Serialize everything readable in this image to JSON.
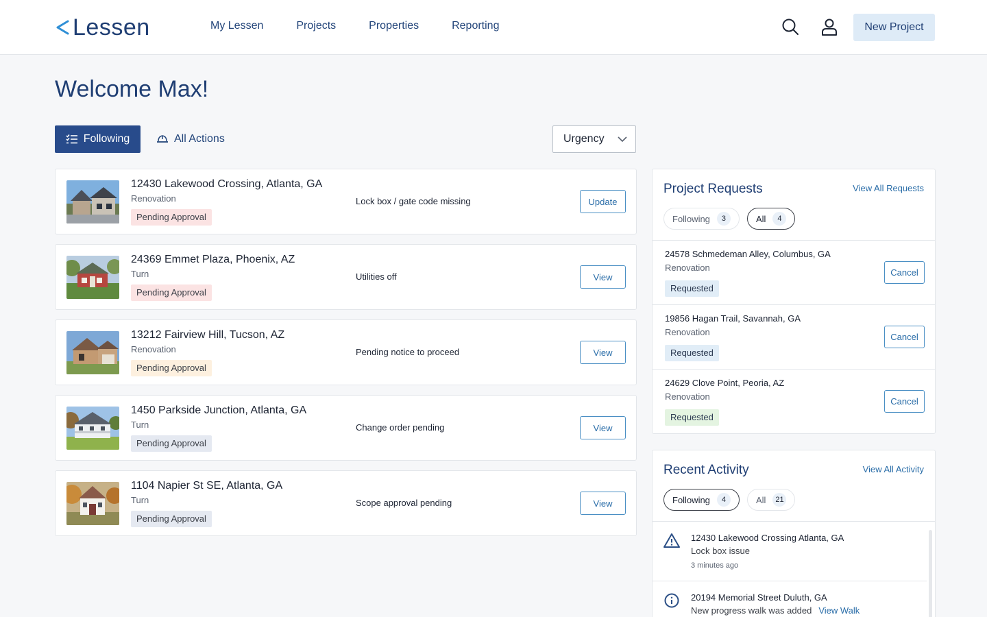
{
  "brand": {
    "name": "Lessen",
    "accent": "#284b8b"
  },
  "nav": [
    "My Lessen",
    "Projects",
    "Properties",
    "Reporting"
  ],
  "header": {
    "new_project": "New Project"
  },
  "welcome": "Welcome Max!",
  "tabs": {
    "following": "Following",
    "all_actions": "All Actions"
  },
  "sort": {
    "selected": "Urgency"
  },
  "properties": [
    {
      "address": "12430 Lakewood Crossing, Atlanta, GA",
      "type": "Renovation",
      "status": "Pending Approval",
      "status_color": "#fbe3e3",
      "issue": "Lock box / gate code missing",
      "action": "Update"
    },
    {
      "address": "24369 Emmet Plaza, Phoenix, AZ",
      "type": "Turn",
      "status": "Pending Approval",
      "status_color": "#fbe3e3",
      "issue": "Utilities off",
      "action": "View"
    },
    {
      "address": "13212 Fairview Hill, Tucson, AZ",
      "type": "Renovation",
      "status": "Pending Approval",
      "status_color": "#fdf0df",
      "issue": "Pending notice to proceed",
      "action": "View"
    },
    {
      "address": "1450 Parkside Junction, Atlanta, GA",
      "type": "Turn",
      "status": "Pending Approval",
      "status_color": "#e5e9f1",
      "issue": "Change order pending",
      "action": "View"
    },
    {
      "address": "1104 Napier St SE, Atlanta, GA",
      "type": "Turn",
      "status": "Pending Approval",
      "status_color": "#e5e9f1",
      "issue": "Scope approval pending",
      "action": "View"
    }
  ],
  "requests": {
    "title": "Project Requests",
    "view_all": "View All Requests",
    "chips": [
      {
        "label": "Following",
        "count": "3"
      },
      {
        "label": "All",
        "count": "4"
      }
    ],
    "items": [
      {
        "address": "24578 Schmedeman Alley, Columbus, GA",
        "type": "Renovation",
        "status": "Requested",
        "status_color": "#e1edf7",
        "action": "Cancel"
      },
      {
        "address": "19856 Hagan Trail, Savannah, GA",
        "type": "Renovation",
        "status": "Requested",
        "status_color": "#e1edf7",
        "action": "Cancel"
      },
      {
        "address": "24629 Clove Point, Peoria, AZ",
        "type": "Renovation",
        "status": "Requested",
        "status_color": "#e4f4e1",
        "action": "Cancel"
      }
    ]
  },
  "activity": {
    "title": "Recent Activity",
    "view_all": "View All Activity",
    "chips": [
      {
        "label": "Following",
        "count": "4"
      },
      {
        "label": "All",
        "count": "21"
      }
    ],
    "items": [
      {
        "icon": "warning-icon",
        "address": "12430 Lakewood Crossing Atlanta, GA",
        "desc": "Lock box issue",
        "time": "3 minutes ago",
        "link": ""
      },
      {
        "icon": "info-icon",
        "address": "20194 Memorial Street Duluth, GA",
        "desc": "New progress walk was added",
        "time": "",
        "link": "View Walk"
      }
    ]
  }
}
